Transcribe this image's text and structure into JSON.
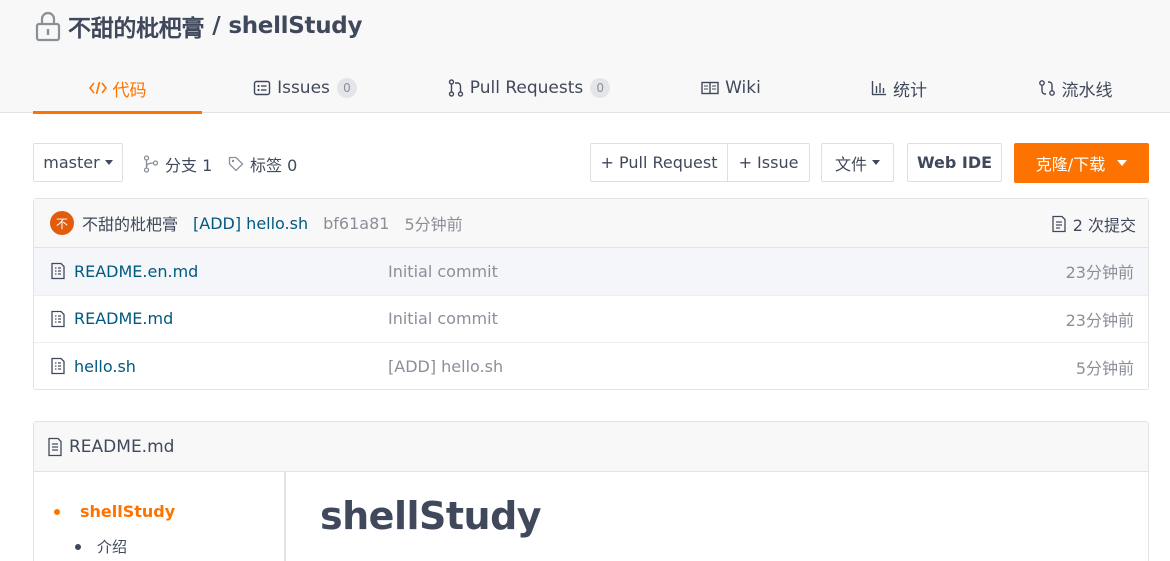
{
  "repo": {
    "owner": "不甜的枇杷膏",
    "separator": "/",
    "name": "shellStudy",
    "icon": "lock-icon"
  },
  "tabs": [
    {
      "label": "代码",
      "icon": "code-icon",
      "active": true
    },
    {
      "label": "Issues",
      "icon": "issues-icon",
      "count": "0"
    },
    {
      "label": "Pull Requests",
      "icon": "pull-request-icon",
      "count": "0"
    },
    {
      "label": "Wiki",
      "icon": "wiki-book-icon"
    },
    {
      "label": "统计",
      "icon": "stats-bar-icon"
    },
    {
      "label": "流水线",
      "icon": "pipeline-icon"
    }
  ],
  "toolbar": {
    "branch": "master",
    "branches_label": "分支 1",
    "tags_label": "标签 0",
    "new_pr_label": "+ Pull Request",
    "new_issue_label": "+ Issue",
    "file_label": "文件",
    "web_ide_label": "Web IDE",
    "clone_label": "克隆/下载"
  },
  "latest_commit": {
    "avatar_text": "不",
    "author": "不甜的枇杷膏",
    "message": "[ADD] hello.sh",
    "sha": "bf61a81",
    "time": "5分钟前",
    "commit_count": "2 次提交"
  },
  "files": [
    {
      "name": "README.en.md",
      "commit": "Initial commit",
      "time": "23分钟前"
    },
    {
      "name": "README.md",
      "commit": "Initial commit",
      "time": "23分钟前"
    },
    {
      "name": "hello.sh",
      "commit": "[ADD] hello.sh",
      "time": "5分钟前"
    }
  ],
  "readme": {
    "filename": "README.md",
    "toc": [
      {
        "label": "shellStudy",
        "level": 1
      },
      {
        "label": "介绍",
        "level": 2
      }
    ],
    "heading": "shellStudy"
  },
  "colors": {
    "accent": "#fe7300",
    "link": "#005980",
    "text": "#40485b",
    "muted": "#8b8f99"
  }
}
